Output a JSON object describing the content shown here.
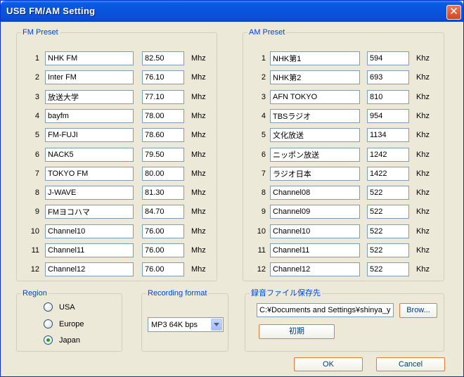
{
  "window": {
    "title": "USB FM/AM Setting",
    "close_glyph": "✕"
  },
  "fm": {
    "legend": "FM Preset",
    "unit": "Mhz",
    "rows": [
      {
        "num": "1",
        "name": "NHK FM",
        "freq": "82.50"
      },
      {
        "num": "2",
        "name": "Inter FM",
        "freq": "76.10"
      },
      {
        "num": "3",
        "name": "放送大学",
        "freq": "77.10"
      },
      {
        "num": "4",
        "name": "bayfm",
        "freq": "78.00"
      },
      {
        "num": "5",
        "name": "FM-FUJI",
        "freq": "78.60"
      },
      {
        "num": "6",
        "name": "NACK5",
        "freq": "79.50"
      },
      {
        "num": "7",
        "name": "TOKYO FM",
        "freq": "80.00"
      },
      {
        "num": "8",
        "name": "J-WAVE",
        "freq": "81.30"
      },
      {
        "num": "9",
        "name": "FMヨコハマ",
        "freq": "84.70"
      },
      {
        "num": "10",
        "name": "Channel10",
        "freq": "76.00"
      },
      {
        "num": "11",
        "name": "Channel11",
        "freq": "76.00"
      },
      {
        "num": "12",
        "name": "Channel12",
        "freq": "76.00"
      }
    ]
  },
  "am": {
    "legend": "AM Preset",
    "unit": "Khz",
    "rows": [
      {
        "num": "1",
        "name": "NHK第1",
        "freq": "594"
      },
      {
        "num": "2",
        "name": "NHK第2",
        "freq": "693"
      },
      {
        "num": "3",
        "name": "AFN TOKYO",
        "freq": "810"
      },
      {
        "num": "4",
        "name": "TBSラジオ",
        "freq": "954"
      },
      {
        "num": "5",
        "name": "文化放送",
        "freq": "1134"
      },
      {
        "num": "6",
        "name": "ニッポン放送",
        "freq": "1242"
      },
      {
        "num": "7",
        "name": "ラジオ日本",
        "freq": "1422"
      },
      {
        "num": "8",
        "name": "Channel08",
        "freq": "522"
      },
      {
        "num": "9",
        "name": "Channel09",
        "freq": "522"
      },
      {
        "num": "10",
        "name": "Channel10",
        "freq": "522"
      },
      {
        "num": "11",
        "name": "Channel11",
        "freq": "522"
      },
      {
        "num": "12",
        "name": "Channel12",
        "freq": "522"
      }
    ]
  },
  "region": {
    "legend": "Region",
    "selected": "Japan",
    "options": [
      "USA",
      "Europe",
      "Japan"
    ]
  },
  "recording": {
    "legend": "Recording format",
    "selected": "MP3 64K bps"
  },
  "save": {
    "legend": "録音ファイル保存先",
    "path": "C:¥Documents and Settings¥shinya_yam",
    "browse_label": "Brow...",
    "init_label": "初期"
  },
  "footer": {
    "ok_label": "OK",
    "cancel_label": "Cancel"
  },
  "colors": {
    "title_bar": "#0855dd",
    "group_label": "#0046d5",
    "button_border": "#e67a3a"
  }
}
